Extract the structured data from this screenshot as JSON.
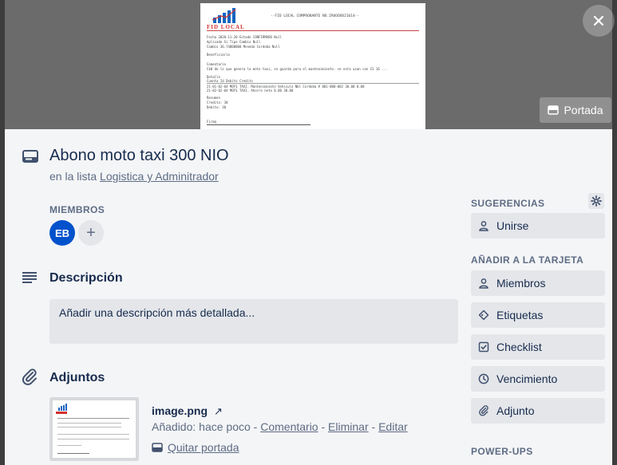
{
  "cover": {
    "cover_button_label": "Portada",
    "document": {
      "logo_text": "FID LOCAL",
      "header_text": "--FID LOCAL COMPROBANTE NO.IRUOOOO21614--",
      "rows": [
        "Fecha        2020-11-20      Estado       CONFIRMADO          Null",
        "Aplicado     Si              Tipo         Cambio              Null",
        "Cambio       36.74000000     Moneda       Cordoba             Null",
        "Beneficiario",
        "Comentario",
        "C$0 de lo que genera la moto taxi, se guarda para el mantenimiento. se esta usan con CS 16 ...",
        "Detalle",
        "Cuenta                                        Id         Debito       Credito",
        "21-01-02-04 MOFS TAXI. Mantenimiento Vehiculo Nbl Cordoba # 001-000-002      30.00        0.00",
        "21-02-02-04 MOFS TAXI. Ahorro neto                                          0.00        30.00",
        "Resumen",
        "Credito:    30",
        "Debito:     30",
        "Firma"
      ]
    }
  },
  "card": {
    "title": "Abono moto taxi 300 NIO",
    "in_list_prefix": "en la lista",
    "list_name": "Logistica y Adminitrador",
    "members_label": "MIEMBROS",
    "member_initials": "EB",
    "add_member_symbol": "+",
    "description_title": "Descripción",
    "description_placeholder": "Añadir una descripción más detallada...",
    "attachments_title": "Adjuntos",
    "attachment": {
      "name": "image.png",
      "arrow": "↗",
      "added": "Añadido: hace poco",
      "sep1": " - ",
      "comment_link": "Comentario",
      "sep2": " - ",
      "delete_link": "Eliminar",
      "sep3": " - ",
      "edit_link": "Editar",
      "remove_cover_link": "Quitar portada"
    }
  },
  "sidebar": {
    "suggestions_label": "SUGERENCIAS",
    "join_button": "Unirse",
    "add_to_card_label": "AÑADIR A LA TARJETA",
    "buttons": [
      "Miembros",
      "Etiquetas",
      "Checklist",
      "Vencimiento",
      "Adjunto"
    ],
    "powerups_label": "POWER-UPS"
  },
  "colors": {
    "avatar": "#0052cc",
    "panel": "#f4f5f7",
    "button": "#e4e6ea",
    "text": "#172b4d",
    "muted": "#5e6c84"
  },
  "icons": [
    "close-icon",
    "card-icon",
    "description-icon",
    "paperclip-icon",
    "gear-icon",
    "person-icon",
    "tag-icon",
    "checklist-icon",
    "clock-icon",
    "external-link-icon",
    "cover-icon"
  ]
}
